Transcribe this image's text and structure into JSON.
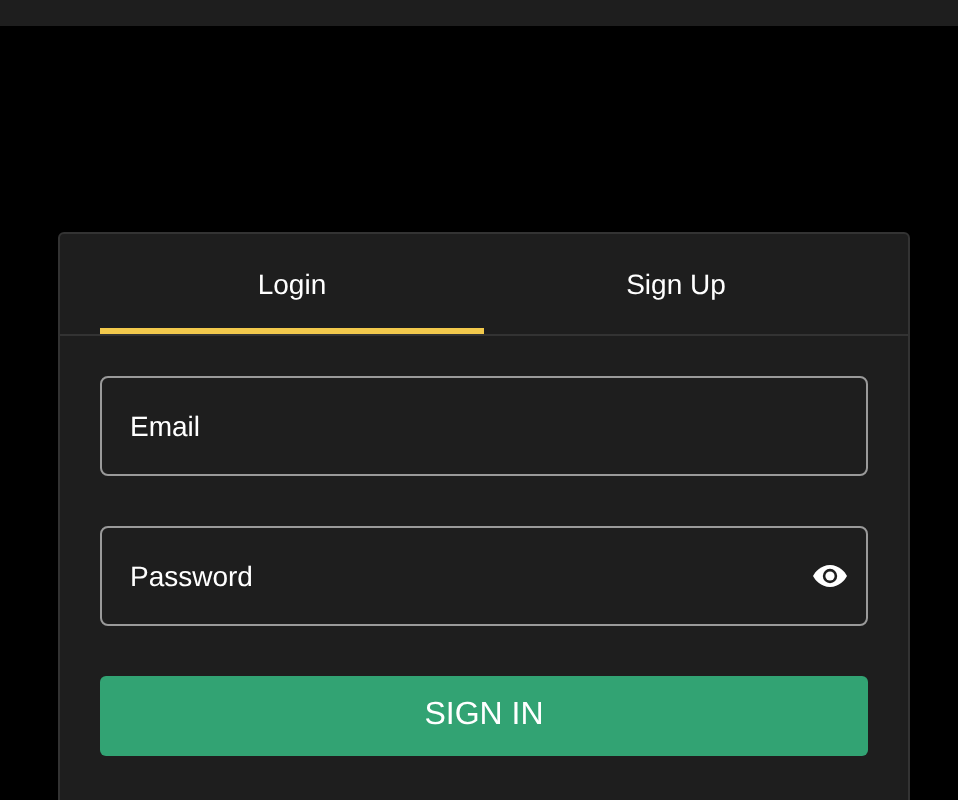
{
  "tabs": [
    {
      "label": "Login",
      "selected": true
    },
    {
      "label": "Sign Up",
      "selected": false
    }
  ],
  "fields": [
    {
      "kind": "text",
      "placeholder": "Email"
    },
    {
      "kind": "password",
      "placeholder": "Password"
    }
  ],
  "submit": "SIGN IN"
}
